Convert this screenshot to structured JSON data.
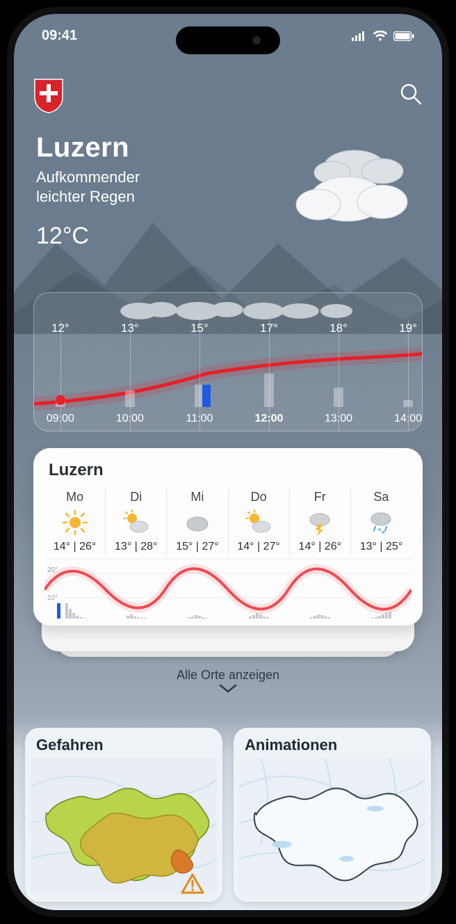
{
  "status": {
    "time": "09:41"
  },
  "header": {
    "city": "Luzern",
    "desc_l1": "Aufkommender",
    "desc_l2": "leichter Regen",
    "temp": "12°C"
  },
  "hourly": {
    "items": [
      {
        "time": "09:00",
        "temp": "12°"
      },
      {
        "time": "10:00",
        "temp": "13°"
      },
      {
        "time": "11:00",
        "temp": "15°"
      },
      {
        "time": "12:00",
        "temp": "17°"
      },
      {
        "time": "13:00",
        "temp": "18°"
      },
      {
        "time": "14:00",
        "temp": "19°"
      }
    ]
  },
  "weekly": {
    "title": "Luzern",
    "days": [
      {
        "label": "Mo",
        "icon": "sun",
        "low": "14°",
        "high": "26°"
      },
      {
        "label": "Di",
        "icon": "sun-cloud",
        "low": "13°",
        "high": "28°"
      },
      {
        "label": "Mi",
        "icon": "cloud",
        "low": "15°",
        "high": "27°"
      },
      {
        "label": "Do",
        "icon": "sun-cloud",
        "low": "14°",
        "high": "27°"
      },
      {
        "label": "Fr",
        "icon": "storm",
        "low": "14°",
        "high": "26°"
      },
      {
        "label": "Sa",
        "icon": "snow-rain",
        "low": "13°",
        "high": "25°"
      }
    ],
    "ticks": {
      "upper": "20°",
      "lower": "10°"
    }
  },
  "all_places": {
    "label": "Alle Orte anzeigen"
  },
  "maps": {
    "hazards": "Gefahren",
    "animations": "Animationen"
  },
  "chart_data": [
    {
      "type": "line",
      "title": "Hourly temperature",
      "x": [
        "09:00",
        "10:00",
        "11:00",
        "12:00",
        "13:00",
        "14:00"
      ],
      "values": [
        12,
        13,
        15,
        17,
        18,
        19
      ],
      "ylabel": "°",
      "ylim": [
        10,
        20
      ],
      "current_x": "09:00",
      "precip_bar_at": "11:00",
      "overlay_bars": {
        "type": "bar",
        "categories": [
          "09:00",
          "10:00",
          "11:00",
          "12:00",
          "13:00",
          "14:00"
        ],
        "values": [
          10,
          25,
          35,
          50,
          30,
          10
        ]
      }
    },
    {
      "type": "line",
      "title": "6-day min/max",
      "categories": [
        "Mo",
        "Di",
        "Mi",
        "Do",
        "Fr",
        "Sa"
      ],
      "series": [
        {
          "name": "high",
          "values": [
            26,
            28,
            27,
            27,
            26,
            25
          ]
        },
        {
          "name": "low",
          "values": [
            14,
            13,
            15,
            14,
            14,
            13
          ]
        }
      ],
      "ylim": [
        10,
        30
      ]
    }
  ]
}
